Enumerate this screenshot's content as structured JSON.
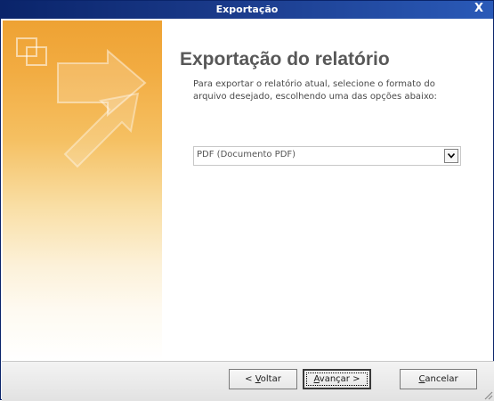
{
  "window": {
    "title": "Exportação",
    "close_glyph": "X"
  },
  "page": {
    "heading": "Exportação do relatório",
    "description": "Para exportar o relatório atual, selecione o formato do arquivo desejado, escolhendo uma das opções abaixo:"
  },
  "format_select": {
    "selected": "PDF (Documento PDF)"
  },
  "buttons": {
    "back": {
      "prefix": "< ",
      "underline": "V",
      "rest": "oltar"
    },
    "next": {
      "prefix": "",
      "underline": "A",
      "rest": "vançar >"
    },
    "cancel": {
      "prefix": "",
      "underline": "C",
      "rest": "ancelar"
    }
  },
  "colors": {
    "titlebar": "#0a246a",
    "side_panel_top": "#eea233",
    "heading_text": "#585858"
  },
  "icons": {
    "side_panel": "export-arrows-icon",
    "dropdown": "chevron-down-icon",
    "close": "close-icon"
  }
}
